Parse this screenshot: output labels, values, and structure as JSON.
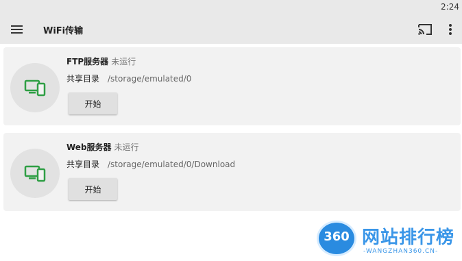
{
  "status_bar": {
    "time": "2:24"
  },
  "app_bar": {
    "title": "WiFi传输"
  },
  "servers": [
    {
      "name": "FTP服务器",
      "status": "未运行",
      "share_label": "共享目录",
      "share_path": "/storage/emulated/0",
      "button_label": "开始",
      "icon": "devices-icon"
    },
    {
      "name": "Web服务器",
      "status": "未运行",
      "share_label": "共享目录",
      "share_path": "/storage/emulated/0/Download",
      "button_label": "开始",
      "icon": "devices-icon"
    }
  ],
  "watermark": {
    "number": "360",
    "text": "网站排行榜",
    "subtext": "-WANGZHAN360.CN-"
  },
  "colors": {
    "bar_bg": "#e9e9e9",
    "card_bg": "#f2f2f2",
    "accent_green": "#2e9e44",
    "watermark_blue": "#3a96e8"
  }
}
